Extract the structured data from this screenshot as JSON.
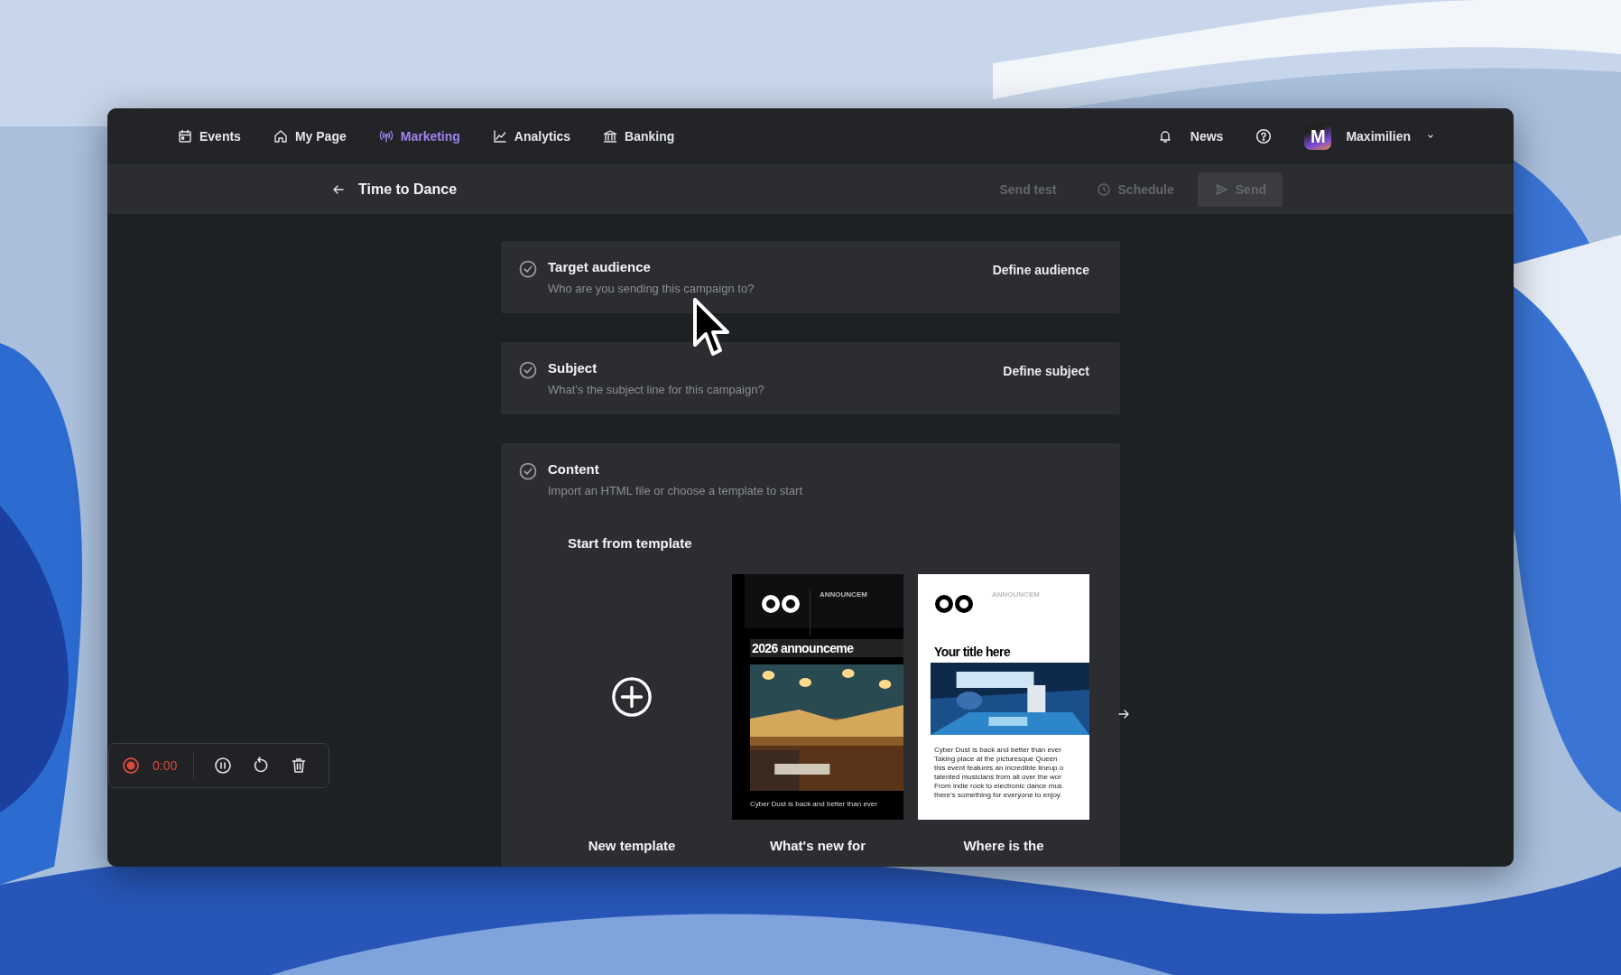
{
  "nav": {
    "items": [
      {
        "label": "Events",
        "selected": false
      },
      {
        "label": "My Page",
        "selected": false
      },
      {
        "label": "Marketing",
        "selected": true
      },
      {
        "label": "Analytics",
        "selected": false
      },
      {
        "label": "Banking",
        "selected": false
      }
    ],
    "news": "News",
    "user": {
      "initial": "M",
      "name": "Maximilien"
    }
  },
  "header": {
    "title": "Time to Dance",
    "actions": [
      {
        "label": "Send test",
        "kind": "text",
        "disabled": true
      },
      {
        "label": "Schedule",
        "kind": "clock",
        "disabled": true
      },
      {
        "label": "Send",
        "kind": "primary",
        "disabled": true
      }
    ]
  },
  "steps": [
    {
      "title": "Target audience",
      "description": "Who are you sending this campaign to?",
      "action": "Define audience"
    },
    {
      "title": "Subject",
      "description": "What’s the subject line for this campaign?",
      "action": "Define subject"
    },
    {
      "title": "Content",
      "description": "Import an HTML file or choose a template to start"
    }
  ],
  "templates": {
    "heading": "Start from template",
    "items": [
      {
        "kind": "new",
        "label": "New template"
      },
      {
        "kind": "dark",
        "label": "What's new for",
        "tag": "ANNOUNCEM",
        "headline": "2026 announceme",
        "body": [
          "Cyber Dust is back and better than ever"
        ]
      },
      {
        "kind": "light",
        "label": "Where is the",
        "tag": "ANNOUNCEM",
        "headline": "Your title here",
        "body": [
          "Cyber Dust is back and better than ever",
          "Taking place at the picturesque Queen",
          "this event features an incredible lineup o",
          "talented musicians from all over the wor",
          "From indie rock to electronic dance mus",
          "there's something for everyone to enjoy."
        ]
      }
    ]
  },
  "recorder": {
    "time": "0:00"
  }
}
